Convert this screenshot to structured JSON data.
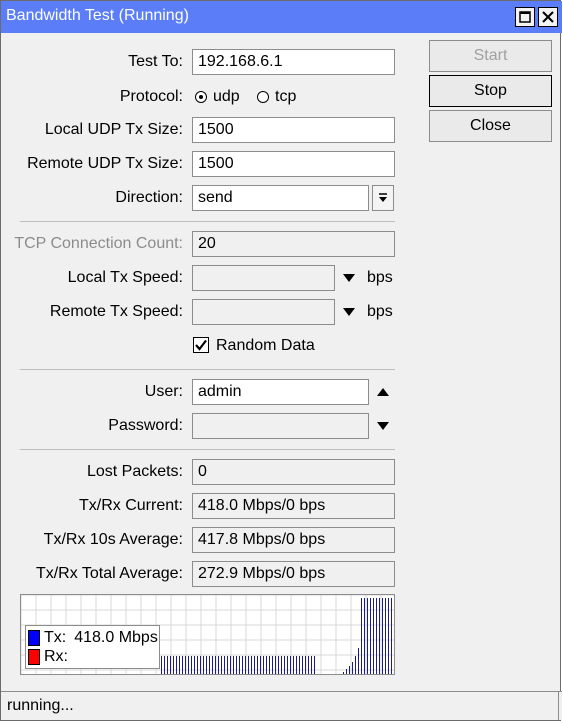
{
  "window": {
    "title": "Bandwidth Test (Running)"
  },
  "form": {
    "test_to": {
      "label": "Test To:",
      "value": "192.168.6.1"
    },
    "protocol": {
      "label": "Protocol:",
      "options": [
        "udp",
        "tcp"
      ],
      "selected": "udp"
    },
    "local_udp_tx_size": {
      "label": "Local UDP Tx Size:",
      "value": "1500"
    },
    "remote_udp_tx_size": {
      "label": "Remote UDP Tx Size:",
      "value": "1500"
    },
    "direction": {
      "label": "Direction:",
      "value": "send"
    },
    "tcp_connection_count": {
      "label": "TCP Connection Count:",
      "value": "20"
    },
    "local_tx_speed": {
      "label": "Local Tx Speed:",
      "value": "",
      "unit": "bps"
    },
    "remote_tx_speed": {
      "label": "Remote Tx Speed:",
      "value": "",
      "unit": "bps"
    },
    "random_data": {
      "label": "Random Data",
      "checked": true
    },
    "user": {
      "label": "User:",
      "value": "admin"
    },
    "password": {
      "label": "Password:",
      "value": ""
    }
  },
  "stats": {
    "lost_packets": {
      "label": "Lost Packets:",
      "value": "0"
    },
    "txrx_current": {
      "label": "Tx/Rx Current:",
      "value": "418.0 Mbps/0 bps"
    },
    "txrx_10s_avg": {
      "label": "Tx/Rx 10s Average:",
      "value": "417.8 Mbps/0 bps"
    },
    "txrx_total_avg": {
      "label": "Tx/Rx Total Average:",
      "value": "272.9 Mbps/0 bps"
    }
  },
  "buttons": {
    "start": "Start",
    "stop": "Stop",
    "close": "Close"
  },
  "graph": {
    "legend": {
      "tx_label": "Tx:",
      "tx_value": "418.0 Mbps",
      "rx_label": "Rx:"
    },
    "colors": {
      "tx": "#0000ff",
      "rx": "#ff0000",
      "bars": "#1a1a8c"
    }
  },
  "status": "running..."
}
